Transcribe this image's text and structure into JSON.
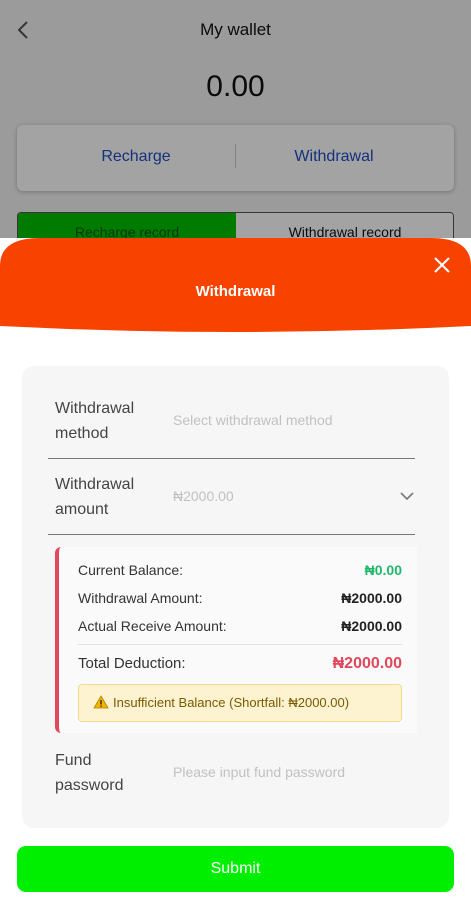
{
  "wallet": {
    "title": "My wallet",
    "balance": "0.00",
    "recharge_label": "Recharge",
    "withdrawal_label": "Withdrawal",
    "tabs": [
      {
        "label": "Recharge record",
        "active": true
      },
      {
        "label": "Withdrawal record",
        "active": false
      }
    ]
  },
  "modal": {
    "title": "Withdrawal",
    "header_color": "#f84300",
    "fields": {
      "method_label": "Withdrawal method",
      "method_placeholder": "Select withdrawal method",
      "amount_label": "Withdrawal amount",
      "amount_value": "₦2000.00",
      "password_label": "Fund password",
      "password_placeholder": "Please input fund password"
    },
    "summary": {
      "current_balance_label": "Current Balance:",
      "current_balance_value": "₦0.00",
      "withdrawal_amount_label": "Withdrawal Amount:",
      "withdrawal_amount_value": "₦2000.00",
      "actual_receive_label": "Actual Receive Amount:",
      "actual_receive_value": "₦2000.00",
      "total_deduction_label": "Total Deduction:",
      "total_deduction_value": "₦2000.00",
      "warning": "Insufficient Balance (Shortfall: ₦2000.00)"
    },
    "submit_label": "Submit",
    "submit_color": "#00ee00"
  },
  "icons": [
    "back-icon",
    "close-icon",
    "chevron-down-icon",
    "warning-icon"
  ]
}
